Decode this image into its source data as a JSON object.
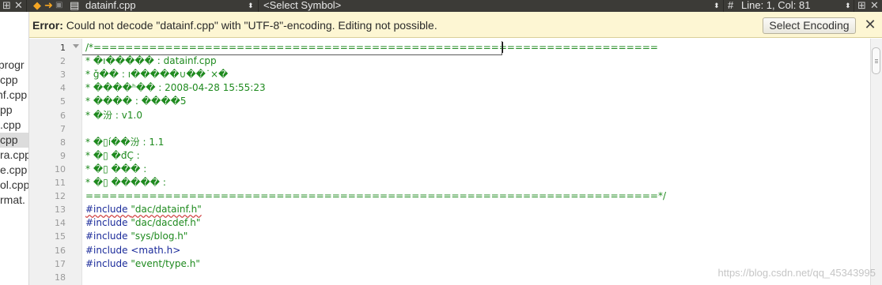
{
  "topbar": {
    "filename": "datainf.cpp",
    "symbol_select": "<Select Symbol>",
    "hash": "#",
    "position": "Line: 1, Col: 81",
    "split_icon_label": "⊞"
  },
  "sidebar": {
    "files": [
      "/progr",
      "cpp",
      "nf.cpp",
      "pp",
      ".cpp",
      "cpp",
      "ra.cpp",
      "e.cpp",
      "ol.cpp",
      "rmat."
    ],
    "selected_index": 5
  },
  "infobar": {
    "error_label": "Error:",
    "message": " Could not decode \"datainf.cpp\" with \"UTF-8\"-encoding. Editing not possible.",
    "button_label": "Select Encoding",
    "close_label": "✕"
  },
  "editor": {
    "current_line": 1,
    "lines": [
      "/*=======================================================================",
      "* �ı����� : datainf.cpp",
      "* ǧ�� : ı�����∪��˙×�",
      "* ����ʰ�� : 2008-04-28 15:55:23",
      "* ���� : ����5",
      "* �汾 : v1.0",
      "",
      "* �▯í��汾 : 1.1",
      "* �▯ �đÇ :",
      "* �▯ ��� :",
      "* �▯ ����� :",
      "========================================================================*/",
      "#include \"dac/datainf.h\"",
      "#include \"dac/dacdef.h\"",
      "#include \"sys/blog.h\"",
      "#include <math.h>",
      "#include \"event/type.h\"",
      ""
    ]
  },
  "watermark": "https://blog.csdn.net/qq_45343995"
}
